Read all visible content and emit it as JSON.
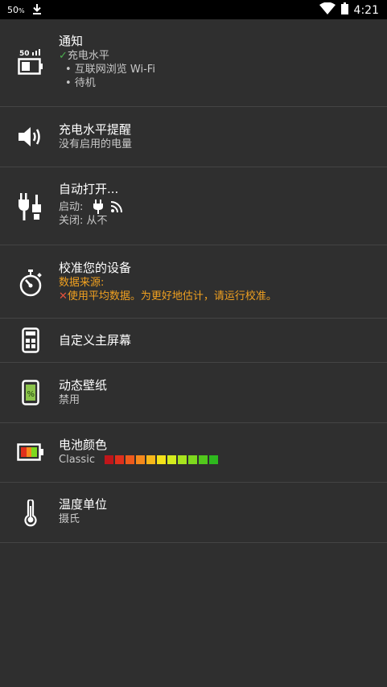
{
  "status_bar": {
    "battery_text": "50",
    "battery_unit": "%",
    "time": "4:21"
  },
  "rows": {
    "notification": {
      "title": "通知",
      "check_mark": "✓",
      "item1": "充电水平",
      "item2": "• 互联网浏览 Wi-Fi",
      "item3": "• 待机",
      "icon_text": "50"
    },
    "charge_alert": {
      "title": "充电水平提醒",
      "subtitle": "没有启用的电量"
    },
    "auto_on": {
      "title": "自动打开...",
      "start_label": "启动:",
      "off_label": "关闭: 从不"
    },
    "calibrate": {
      "title": "校准您的设备",
      "source_label": "数据来源:",
      "cross_mark": "✕",
      "source_text": "使用平均数据。为更好地估计，请运行校准。"
    },
    "home_screen": {
      "title": "自定义主屏幕"
    },
    "wallpaper": {
      "title": "动态壁纸",
      "subtitle": "禁用",
      "icon_text": "%"
    },
    "battery_color": {
      "title": "电池颜色",
      "subtitle": "Classic",
      "swatches": [
        "#c0161a",
        "#e0301c",
        "#ee5a1c",
        "#f5891c",
        "#f8b81a",
        "#f4e21a",
        "#d4ec1e",
        "#a8e41e",
        "#7ed81e",
        "#52c81c",
        "#2eb81e"
      ]
    },
    "temperature": {
      "title": "温度单位",
      "subtitle": "摄氏"
    }
  }
}
